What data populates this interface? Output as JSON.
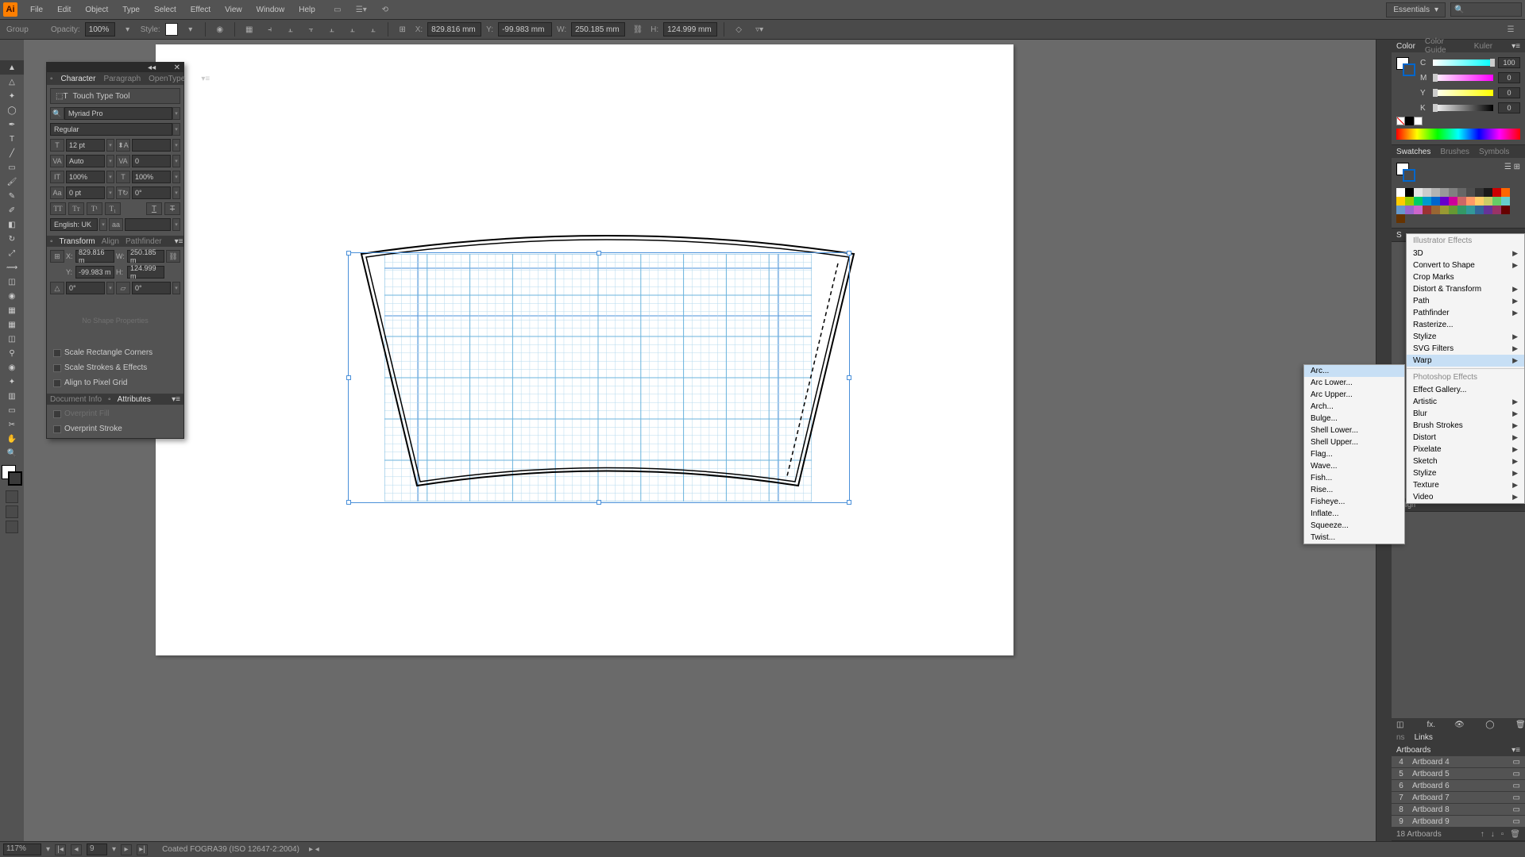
{
  "menubar": {
    "items": [
      "File",
      "Edit",
      "Object",
      "Type",
      "Select",
      "Effect",
      "View",
      "Window",
      "Help"
    ]
  },
  "workspace": {
    "label": "Essentials"
  },
  "control": {
    "selection": "Group",
    "opacity_label": "Opacity:",
    "opacity": "100%",
    "style_label": "Style:",
    "x_label": "X:",
    "x": "829.816 mm",
    "y_label": "Y:",
    "y": "-99.983 mm",
    "w_label": "W:",
    "w": "250.185 mm",
    "h_label": "H:",
    "h": "124.999 mm"
  },
  "char_panel": {
    "tabs": [
      "Character",
      "Paragraph",
      "OpenType"
    ],
    "touch_type": "Touch Type Tool",
    "font": "Myriad Pro",
    "style": "Regular",
    "size": "12 pt",
    "leading": "",
    "kerning": "Auto",
    "tracking": "0",
    "vscale": "100%",
    "hscale": "100%",
    "baseline": "0 pt",
    "rotation": "0°",
    "lang": "English: UK",
    "transform_tabs": [
      "Transform",
      "Align",
      "Pathfinder"
    ],
    "tx": "829.816 m",
    "ty": "-99.983 m",
    "tw": "250.185 m",
    "th": "124.999 m",
    "rot1": "0°",
    "rot2": "0°",
    "no_shape": "No Shape Properties",
    "scale_rect": "Scale Rectangle Corners",
    "scale_strokes": "Scale Strokes & Effects",
    "align_pixel": "Align to Pixel Grid",
    "docinfo_tabs": [
      "Document Info",
      "Attributes"
    ],
    "overprint_fill": "Overprint Fill",
    "overprint_stroke": "Overprint Stroke"
  },
  "color": {
    "tabs": [
      "Color",
      "Color Guide",
      "Kuler"
    ],
    "c": "100",
    "m": "0",
    "y": "0",
    "k": "0"
  },
  "swatches": {
    "tabs": [
      "Swatches",
      "Brushes",
      "Symbols"
    ]
  },
  "fx_menu": {
    "header1": "Illustrator Effects",
    "items1": [
      {
        "l": "3D",
        "a": true
      },
      {
        "l": "Convert to Shape",
        "a": true
      },
      {
        "l": "Crop Marks",
        "a": false
      },
      {
        "l": "Distort & Transform",
        "a": true
      },
      {
        "l": "Path",
        "a": true
      },
      {
        "l": "Pathfinder",
        "a": true
      },
      {
        "l": "Rasterize...",
        "a": false
      },
      {
        "l": "Stylize",
        "a": true
      },
      {
        "l": "SVG Filters",
        "a": true
      },
      {
        "l": "Warp",
        "a": true,
        "hl": true
      }
    ],
    "header2": "Photoshop Effects",
    "items2": [
      {
        "l": "Effect Gallery...",
        "a": false
      },
      {
        "l": "Artistic",
        "a": true
      },
      {
        "l": "Blur",
        "a": true
      },
      {
        "l": "Brush Strokes",
        "a": true
      },
      {
        "l": "Distort",
        "a": true
      },
      {
        "l": "Pixelate",
        "a": true
      },
      {
        "l": "Sketch",
        "a": true
      },
      {
        "l": "Stylize",
        "a": true
      },
      {
        "l": "Texture",
        "a": true
      },
      {
        "l": "Video",
        "a": true
      }
    ]
  },
  "warp_menu": {
    "items": [
      "Arc...",
      "Arc Lower...",
      "Arc Upper...",
      "Arch...",
      "Bulge...",
      "Shell Lower...",
      "Shell Upper...",
      "Flag...",
      "Wave...",
      "Fish...",
      "Rise...",
      "Fisheye...",
      "Inflate...",
      "Squeeze...",
      "Twist..."
    ]
  },
  "links": {
    "tabs": [
      "ns",
      "Links"
    ]
  },
  "artboards": {
    "tab": "Artboards",
    "rows": [
      {
        "n": "4",
        "name": "Artboard 4"
      },
      {
        "n": "5",
        "name": "Artboard 5"
      },
      {
        "n": "6",
        "name": "Artboard 6"
      },
      {
        "n": "7",
        "name": "Artboard 7"
      },
      {
        "n": "8",
        "name": "Artboard 8"
      },
      {
        "n": "9",
        "name": "Artboard 9",
        "sel": true
      }
    ],
    "count": "18 Artboards"
  },
  "align": {
    "label": "Align"
  },
  "stroke_label": "S",
  "status": {
    "zoom": "117%",
    "page": "9",
    "profile": "Coated FOGRA39 (ISO 12647-2:2004)"
  }
}
